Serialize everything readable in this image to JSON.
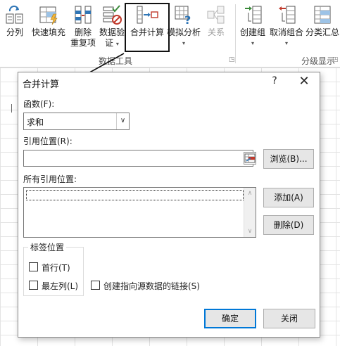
{
  "ribbon": {
    "buttons": [
      {
        "label1": "分列",
        "label2": ""
      },
      {
        "label1": "快速填充",
        "label2": ""
      },
      {
        "label1": "删除",
        "label2": "重复项"
      },
      {
        "label1": "数据验",
        "label2": "证"
      },
      {
        "label1": "合并计算",
        "label2": ""
      },
      {
        "label1": "模拟分析",
        "label2": ""
      },
      {
        "label1": "关系",
        "label2": ""
      },
      {
        "label1": "创建组",
        "label2": ""
      },
      {
        "label1": "取消组合",
        "label2": ""
      },
      {
        "label1": "分类汇总",
        "label2": ""
      }
    ],
    "caret": "▾",
    "group_data_tools": "数据工具",
    "group_outline": "分级显示",
    "launcher": "◳"
  },
  "dialog": {
    "title": "合并计算",
    "help": "?",
    "close": "✕",
    "function_label": "函数(F):",
    "function_value": "求和",
    "combo_arrow": "∨",
    "reference_label": "引用位置(R):",
    "reference_value": "",
    "browse_button": "浏览(B)...",
    "all_references_label": "所有引用位置:",
    "add_button": "添加(A)",
    "delete_button": "删除(D)",
    "scroll_up": "∧",
    "scroll_down": "∨",
    "labels_group": "标签位置",
    "top_row": "首行(T)",
    "left_column": "最左列(L)",
    "link_source": "创建指向源数据的链接(S)",
    "ok_button": "确定",
    "close_button": "关闭"
  },
  "colors": {
    "accent": "#0078d7",
    "icon_blue": "#2e75b6",
    "icon_green": "#3a8a3a",
    "icon_red": "#c0392b"
  }
}
